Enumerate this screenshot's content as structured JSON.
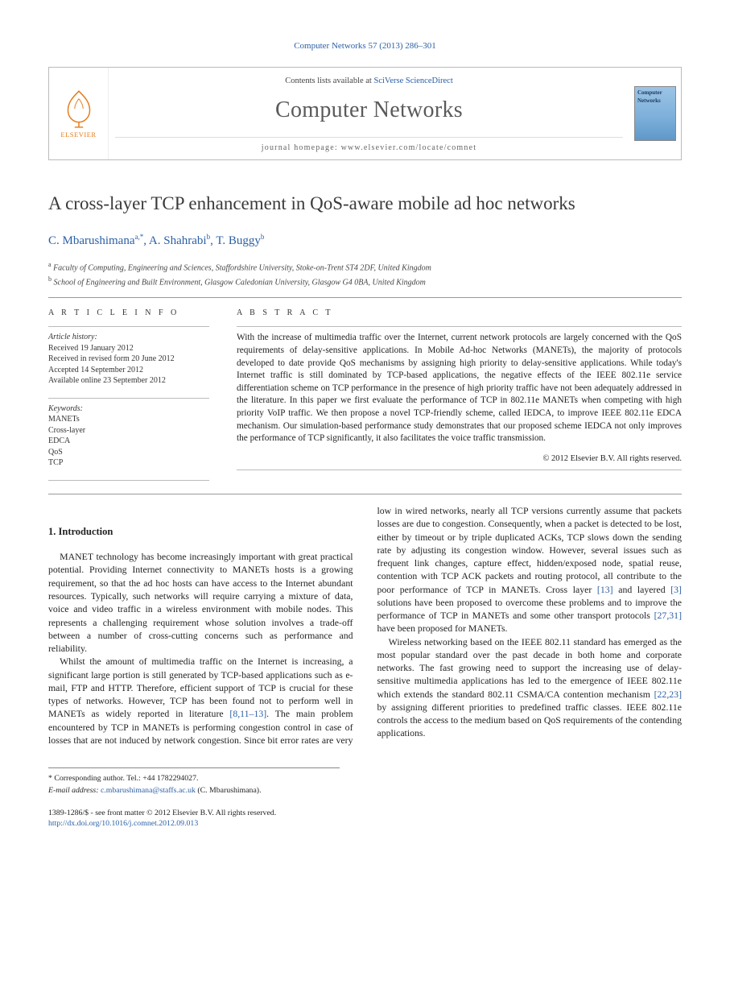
{
  "journal_ref": "Computer Networks 57 (2013) 286–301",
  "header": {
    "contents_prefix": "Contents lists available at ",
    "contents_link": "SciVerse ScienceDirect",
    "journal_name": "Computer Networks",
    "homepage_label": "journal homepage: www.elsevier.com/locate/comnet",
    "elsevier_label": "ELSEVIER",
    "cover_title": "Computer Networks"
  },
  "title": "A cross-layer TCP enhancement in QoS-aware mobile ad hoc networks",
  "authors_html": {
    "a1_name": "C. Mbarushimana",
    "a1_sup": "a,",
    "a1_star": "*",
    "a2_name": "A. Shahrabi",
    "a2_sup": "b",
    "a3_name": "T. Buggy",
    "a3_sup": "b"
  },
  "affiliations": {
    "a": "Faculty of Computing, Engineering and Sciences, Staffordshire University, Stoke-on-Trent ST4 2DF, United Kingdom",
    "b": "School of Engineering and Built Environment, Glasgow Caledonian University, Glasgow G4 0BA, United Kingdom"
  },
  "info": {
    "heading": "A R T I C L E   I N F O",
    "history_label": "Article history:",
    "received": "Received 19 January 2012",
    "revised": "Received in revised form 20 June 2012",
    "accepted": "Accepted 14 September 2012",
    "online": "Available online 23 September 2012",
    "keywords_label": "Keywords:",
    "keywords": [
      "MANETs",
      "Cross-layer",
      "EDCA",
      "QoS",
      "TCP"
    ]
  },
  "abstract": {
    "heading": "A B S T R A C T",
    "text": "With the increase of multimedia traffic over the Internet, current network protocols are largely concerned with the QoS requirements of delay-sensitive applications. In Mobile Ad-hoc Networks (MANETs), the majority of protocols developed to date provide QoS mechanisms by assigning high priority to delay-sensitive applications. While today's Internet traffic is still dominated by TCP-based applications, the negative effects of the IEEE 802.11e service differentiation scheme on TCP performance in the presence of high priority traffic have not been adequately addressed in the literature. In this paper we first evaluate the performance of TCP in 802.11e MANETs when competing with high priority VoIP traffic. We then propose a novel TCP-friendly scheme, called IEDCA, to improve IEEE 802.11e EDCA mechanism. Our simulation-based performance study demonstrates that our proposed scheme IEDCA not only improves the performance of TCP significantly, it also facilitates the voice traffic transmission.",
    "copyright": "© 2012 Elsevier B.V. All rights reserved."
  },
  "section1_heading": "1. Introduction",
  "body": {
    "p1": "MANET technology has become increasingly important with great practical potential. Providing Internet connectivity to MANETs hosts is a growing requirement, so that the ad hoc hosts can have access to the Internet abundant resources. Typically, such networks will require carrying a mixture of data, voice and video traffic in a wireless environment with mobile nodes. This represents a challenging requirement whose solution involves a trade-off between a number of cross-cutting concerns such as performance and reliability.",
    "p2a": "Whilst the amount of multimedia traffic on the Internet is increasing, a significant large portion is still generated by TCP-based applications such as e-mail, FTP and HTTP. Therefore, efficient support of TCP is crucial for these types of networks. However, TCP has been found not to perform well in MANETs as widely reported in literature ",
    "p2_ref1": "[8,11–13]",
    "p2b": ". The main problem encountered by TCP in MANETs is performing congestion control in case of losses that are not ",
    "p2c": "induced by network congestion. Since bit error rates are very low in wired networks, nearly all TCP versions currently assume that packets losses are due to congestion. Consequently, when a packet is detected to be lost, either by timeout or by triple duplicated ACKs, TCP slows down the sending rate by adjusting its congestion window. However, several issues such as frequent link changes, capture effect, hidden/exposed node, spatial reuse, contention with TCP ACK packets and routing protocol, all contribute to the poor performance of TCP in MANETs. Cross layer ",
    "p2_ref2": "[13]",
    "p2d": " and layered ",
    "p2_ref3": "[3]",
    "p2e": " solutions have been proposed to overcome these problems and to improve the performance of TCP in MANETs and some other transport protocols ",
    "p2_ref4": "[27,31]",
    "p2f": " have been proposed for MANETs.",
    "p3a": "Wireless networking based on the IEEE 802.11 standard has emerged as the most popular standard over the past decade in both home and corporate networks. The fast growing need to support the increasing use of delay-sensitive multimedia applications has led to the emergence of IEEE 802.11e which extends the standard 802.11 CSMA/CA contention mechanism ",
    "p3_ref1": "[22,23]",
    "p3b": " by assigning different priorities to predefined traffic classes. IEEE 802.11e controls the access to the medium based on QoS requirements of the contending applications."
  },
  "footnote": {
    "corr_label": "* Corresponding author. Tel.: +44 1782294027.",
    "email_label": "E-mail address:",
    "email": "c.mbarushimana@staffs.ac.uk",
    "email_who": "(C. Mbarushimana)."
  },
  "bottom": {
    "issn_line": "1389-1286/$ - see front matter © 2012 Elsevier B.V. All rights reserved.",
    "doi": "http://dx.doi.org/10.1016/j.comnet.2012.09.013"
  }
}
